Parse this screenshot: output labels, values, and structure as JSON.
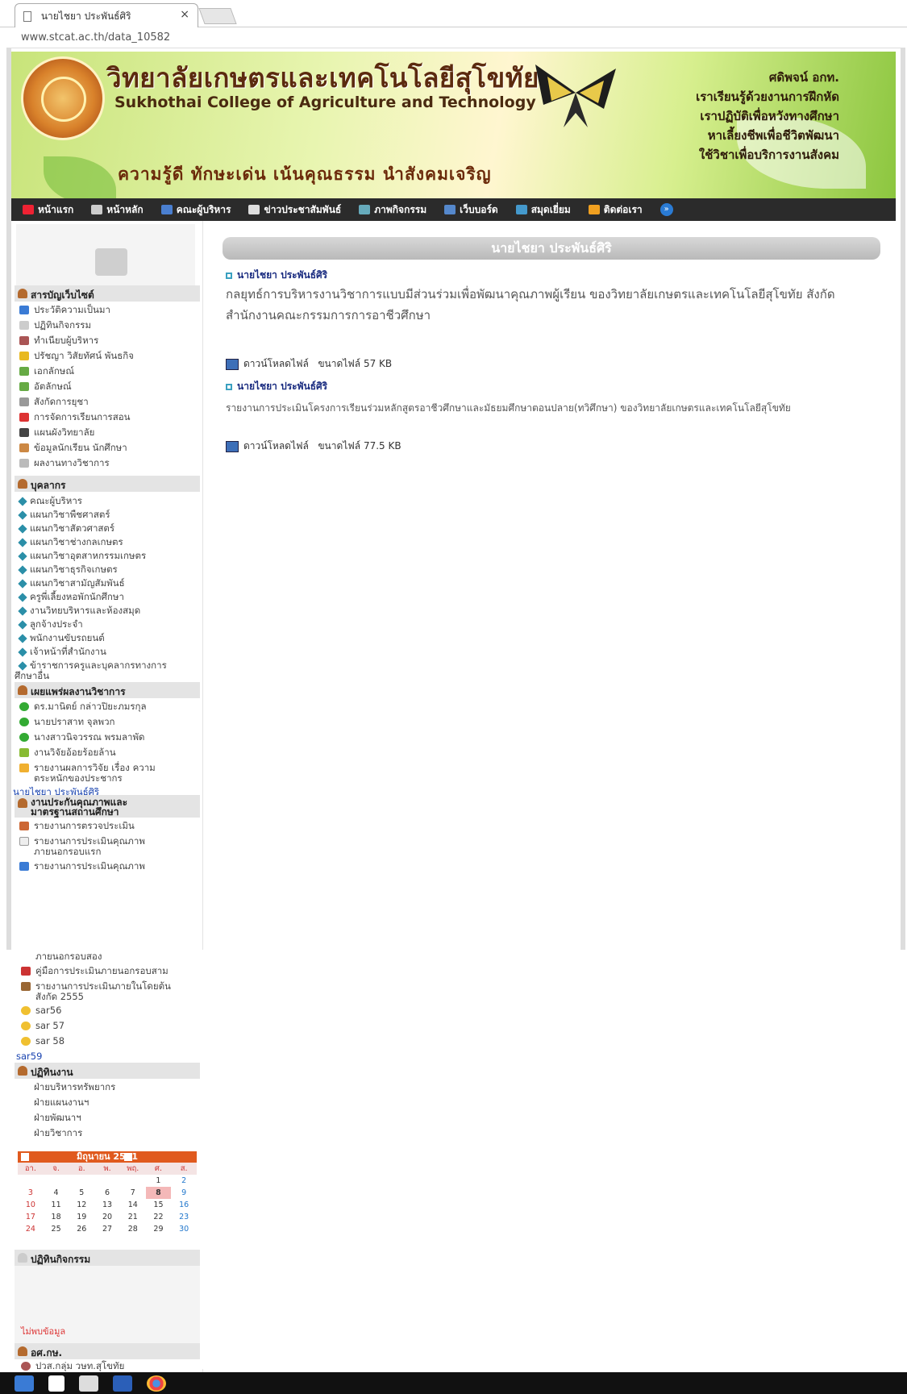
{
  "browser": {
    "tab_title": "นายไชยา ประพันธ์ศิริ",
    "address": "www.stcat.ac.th/data_10582"
  },
  "banner": {
    "title_th": "วิทยาลัยเกษตรและเทคโนโลยีสุโขทัย",
    "title_en": "Sukhothai College of Agriculture and Technology",
    "slogan": "ความรู้ดี  ทักษะเด่น  เน้นคุณธรรม  นำสังคมเจริญ",
    "motto": [
      "ศดิพจน์ อกท.",
      "เราเรียนรู้ด้วยงานการฝึกหัด",
      "เราปฏิบัติเพื่อหวังทางศึกษา",
      "หาเลี้ยงชีพเพื่อชีวิตพัฒนา",
      "ใช้วิชาเพื่อบริการงานสังคม"
    ]
  },
  "nav": [
    "หน้าแรก",
    "หน้าหลัก",
    "คณะผู้บริหาร",
    "ข่าวประชาสัมพันธ์",
    "ภาพกิจกรรม",
    "เว็บบอร์ด",
    "สมุดเยี่ยม",
    "ติดต่อเรา"
  ],
  "sidebar": {
    "sec1": "สารบัญเว็บไซต์",
    "menu1": [
      "ประวัติความเป็นมา",
      "ปฏิทินกิจกรรม",
      "ทำเนียบผู้บริหาร",
      "ปรัชญา วิสัยทัศน์ พันธกิจ",
      "เอกลักษณ์",
      "อัตลักษณ์",
      "สังกัดการยุชา",
      "การจัดการเรียนการสอน",
      "แผนผังวิทยาลัย",
      "ข้อมูลนักเรียน นักศึกษา",
      "ผลงานทางวิชาการ"
    ],
    "sec2": "บุคลากร",
    "menu2": [
      "คณะผู้บริหาร",
      "แผนกวิชาพืชศาสตร์",
      "แผนกวิชาสัตวศาสตร์",
      "แผนกวิชาช่างกลเกษตร",
      "แผนกวิชาอุตสาหกรรมเกษตร",
      "แผนกวิชาธุรกิจเกษตร",
      "แผนกวิชาสามัญสัมพันธ์",
      "ครูพี่เลี้ยงหอพักนักศึกษา",
      "งานวิทยบริหารและห้องสมุด",
      "ลูกจ้างประจำ",
      "พนักงานขับรถยนต์",
      "เจ้าหน้าที่สำนักงาน",
      "ข้าราชการครูและบุคลากรทางการ",
      "ศึกษาอื่น"
    ],
    "sec3": "เผยแพร่ผลงานวิชาการ",
    "menu3": [
      "ดร.มานิตย์ กล่าวปิยะภมรกุล",
      "นายปราสาท จุลพวก",
      "นางสาวนิจวรรณ พรมลาพัด",
      "งานวิจัยอ้อยร้อยล้าน",
      "รายงานผลการวิจัย เรื่อง ความ",
      "ตระหนักของประชากร"
    ],
    "img_link": "นายไชยา ประพันธ์ศิริ",
    "sec4a": "งานประกันคุณภาพและ",
    "sec4b": "มาตรฐานสถานศึกษา",
    "menu4": [
      "รายงานการตรวจประเมิน",
      "รายงานการประเมินคุณภาพ",
      "ภายนอกรอบแรก",
      "รายงานการประเมินคุณภาพ",
      "ภายนอกรอบสอง",
      "คู่มือการประเมินภายนอกรอบสาม",
      "รายงานการประเมินภายในโดยต้น",
      "สังกัด 2555",
      "sar56",
      "sar 57",
      "sar 58"
    ],
    "sar59": "sar59",
    "sec5": "ปฏิทินงาน",
    "menu5": [
      "ฝ่ายบริหารทรัพยากร",
      "ฝ่ายแผนงานฯ",
      "ฝ่ายพัฒนาฯ",
      "ฝ่ายวิชาการ"
    ],
    "calendar": {
      "month": "มิถุนายน 2561",
      "days": [
        "อา.",
        "จ.",
        "อ.",
        "พ.",
        "พฤ.",
        "ศ.",
        "ส."
      ],
      "weeks": [
        [
          "",
          "",
          "",
          "",
          "",
          "1",
          "2"
        ],
        [
          "3",
          "4",
          "5",
          "6",
          "7",
          "8",
          "9"
        ],
        [
          "10",
          "11",
          "12",
          "13",
          "14",
          "15",
          "16"
        ],
        [
          "17",
          "18",
          "19",
          "20",
          "21",
          "22",
          "23"
        ],
        [
          "24",
          "25",
          "26",
          "27",
          "28",
          "29",
          "30"
        ]
      ]
    },
    "sec6": "ปฏิทินกิจกรรม",
    "no_data": "ไม่พบข้อมูล",
    "sec7": "อศ.กษ.",
    "last_item": "ปวส.กลุ่ม วษท.สุโขทัย"
  },
  "main": {
    "title": "นายไชยา ประพันธ์ศิริ",
    "entries": [
      {
        "author": "นายไชยา ประพันธ์ศิริ",
        "desc": "กลยุทธ์การบริหารงานวิชาการแบบมีส่วนร่วมเพื่อพัฒนาคุณภาพผู้เรียน ของวิทยาลัยเกษตรและเทคโนโลยีสุโขทัย สังกัดสำนักงานคณะกรรมการการอาชีวศึกษา",
        "download": "ดาวน์โหลดไฟล์",
        "size": "ขนาดไฟล์ 57 KB"
      },
      {
        "author": "นายไชยา ประพันธ์ศิริ",
        "desc": "รายงานการประเมินโครงการเรียนร่วมหลักสูตรอาชีวศึกษาและมัธยมศึกษาตอนปลาย(ทวิศึกษา) ของวิทยาลัยเกษตรและเทคโนโลยีสุโขทัย",
        "download": "ดาวน์โหลดไฟล์",
        "size": "ขนาดไฟล์ 77.5 KB"
      }
    ]
  },
  "colors": {
    "nav_bg": "#2b2b2b",
    "calendar_header": "#e05a1e",
    "title_bar": "#bdbdbd",
    "link": "#1a44b0"
  }
}
